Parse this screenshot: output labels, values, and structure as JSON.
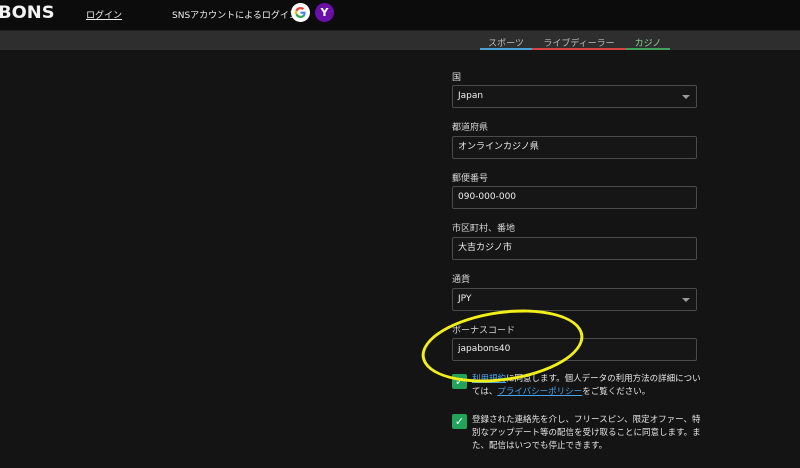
{
  "header": {
    "logo_text": "BONS",
    "login_link": "ログイン",
    "sns_label": "SNSアカウントによるログイン:",
    "google_icon": "google-icon",
    "yahoo_icon": "yahoo-icon",
    "yahoo_glyph": "Y"
  },
  "tabs": [
    {
      "label": "スポーツ",
      "color": "#4a9fd8"
    },
    {
      "label": "ライブディーラー",
      "color": "#d84444"
    },
    {
      "label": "カジノ",
      "color": "#3fa05a"
    }
  ],
  "form": {
    "country": {
      "label": "国",
      "value": "Japan"
    },
    "prefecture": {
      "label": "都道府県",
      "value": "オンラインカジノ県"
    },
    "postal": {
      "label": "郵便番号",
      "value": "090-000-000"
    },
    "city": {
      "label": "市区町村、番地",
      "value": "大吉カジノ市"
    },
    "currency": {
      "label": "通貨",
      "value": "JPY"
    },
    "bonus_code": {
      "label": "ボーナスコード",
      "value": "japabons40"
    }
  },
  "consents": {
    "terms_link": "利用規約",
    "terms_text_1": "に同意します。個人データの利用方法の詳細については、",
    "privacy_link": "プライバシーポリシー",
    "terms_text_2": "をご覧ください。",
    "marketing_text": "登録された連絡先を介し、フリースピン、限定オファー、特別なアップデート等の配信を受け取ることに同意します。また、配信はいつでも停止できます。"
  },
  "colors": {
    "accent_green": "#21a35a",
    "highlight_yellow": "#f2ee1a",
    "link_blue": "#4aa3e8"
  }
}
